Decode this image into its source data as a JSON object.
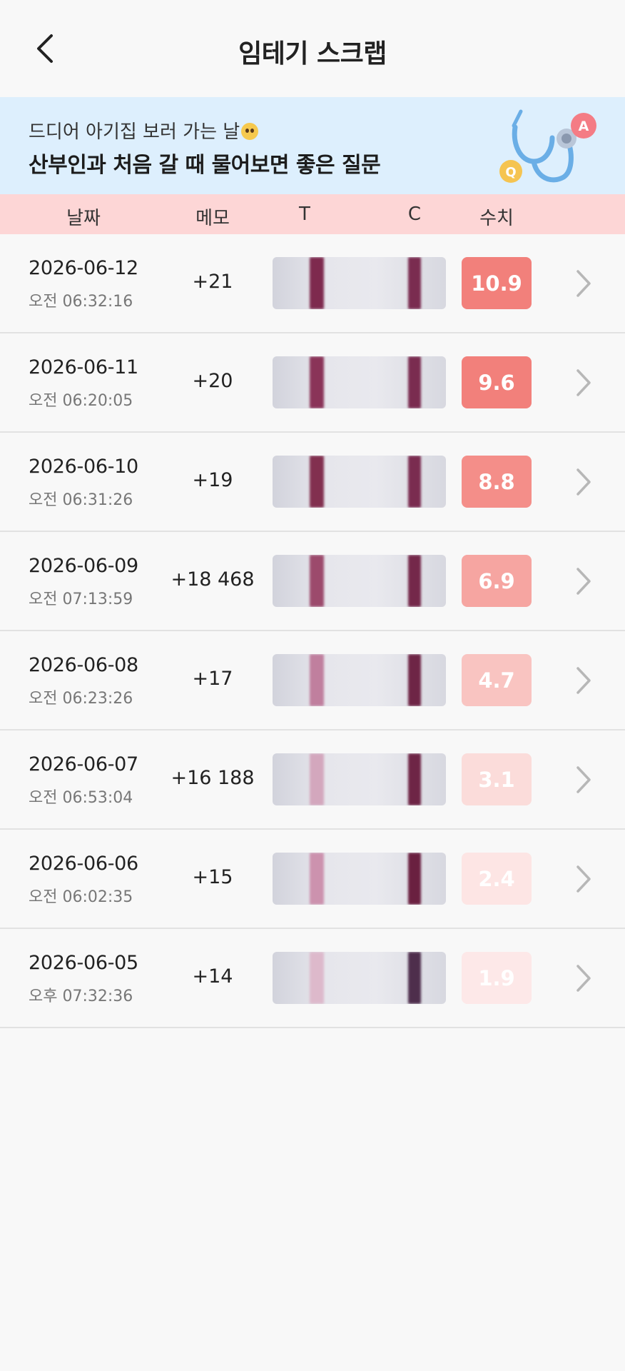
{
  "header": {
    "title": "임테기 스크랩"
  },
  "banner": {
    "subtitle": "드디어 아기집 보러 가는 날",
    "title": "산부인과 처음 갈 때 물어보면 좋은 질문",
    "badge_q": "Q",
    "badge_a": "A"
  },
  "columns": {
    "date": "날짜",
    "memo": "메모",
    "t": "T",
    "c": "C",
    "value": "수치"
  },
  "rows": [
    {
      "date": "2026-06-12",
      "time": "오전 06:32:16",
      "memo": "+21",
      "value": "10.9",
      "badge_color": "#f2807b",
      "badge_text_color": "#ffffff",
      "t_color": "#7e2a4e",
      "c_color": "#7a2c50"
    },
    {
      "date": "2026-06-11",
      "time": "오전 06:20:05",
      "memo": "+20",
      "value": "9.6",
      "badge_color": "#f2807b",
      "badge_text_color": "#ffffff",
      "t_color": "#8a3458",
      "c_color": "#7a2c50"
    },
    {
      "date": "2026-06-10",
      "time": "오전 06:31:26",
      "memo": "+19",
      "value": "8.8",
      "badge_color": "#f48e89",
      "badge_text_color": "#ffffff",
      "t_color": "#82304f",
      "c_color": "#7a2c50"
    },
    {
      "date": "2026-06-09",
      "time": "오전 07:13:59",
      "memo": "+18 468",
      "value": "6.9",
      "badge_color": "#f6a5a1",
      "badge_text_color": "#ffffff",
      "t_color": "#9c4a6c",
      "c_color": "#74284a"
    },
    {
      "date": "2026-06-08",
      "time": "오전 06:23:26",
      "memo": "+17",
      "value": "4.7",
      "badge_color": "#f9c4c1",
      "badge_text_color": "#ffffff",
      "t_color": "#c07f9e",
      "c_color": "#6e2546"
    },
    {
      "date": "2026-06-07",
      "time": "오전 06:53:04",
      "memo": "+16 188",
      "value": "3.1",
      "badge_color": "#fbdcda",
      "badge_text_color": "#ffffff",
      "t_color": "#d3a7bd",
      "c_color": "#6e2546"
    },
    {
      "date": "2026-06-06",
      "time": "오전 06:02:35",
      "memo": "+15",
      "value": "2.4",
      "badge_color": "#fde5e4",
      "badge_text_color": "#ffffff",
      "t_color": "#cc92ae",
      "c_color": "#6a2040"
    },
    {
      "date": "2026-06-05",
      "time": "오후 07:32:36",
      "memo": "+14",
      "value": "1.9",
      "badge_color": "#fde8e8",
      "badge_text_color": "#ffffff",
      "t_color": "#ddb9cb",
      "c_color": "#4e2e4c"
    }
  ]
}
